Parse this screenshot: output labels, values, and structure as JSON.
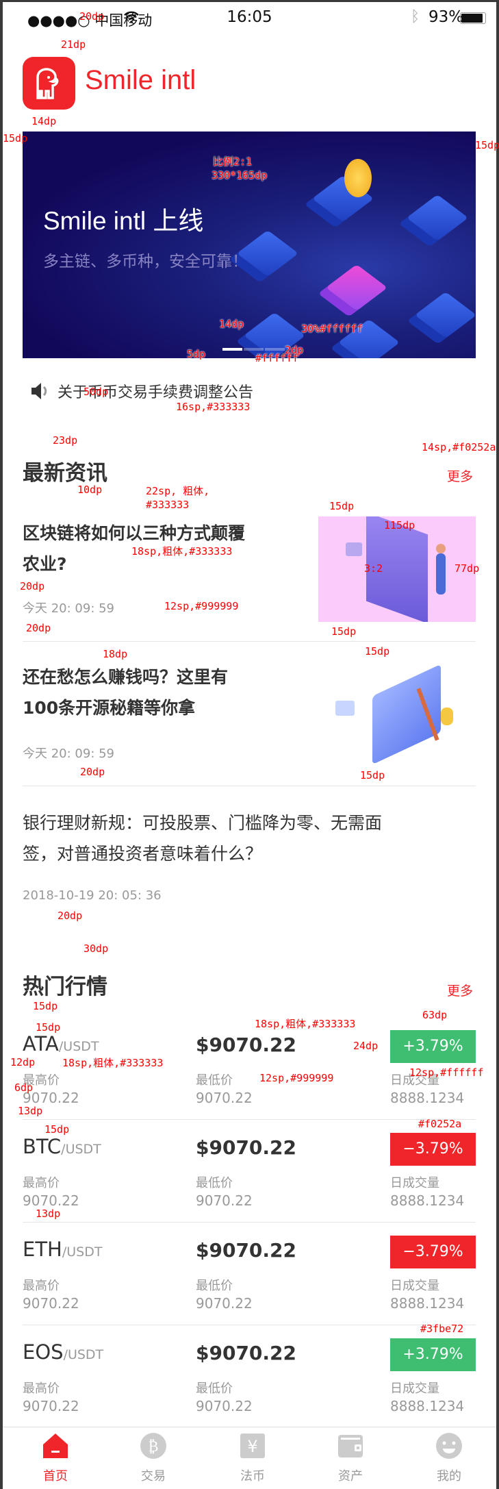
{
  "status_bar": {
    "carrier": "●●●●○ 中国移动",
    "time": "16:05",
    "battery": "93%"
  },
  "header": {
    "app_name": "Smile intl"
  },
  "banner": {
    "title": "Smile intl  上线",
    "subtitle": "多主链、多币种，安全可靠！",
    "slides": 3,
    "active_slide": 0
  },
  "notice": {
    "text": "关于币币交易手续费调整公告"
  },
  "news": {
    "title": "最新资讯",
    "more": "更多",
    "items": [
      {
        "title_l1": "区块链将如何以三种方式颠覆",
        "title_l2": "农业?",
        "time": "今天  20: 09: 59"
      },
      {
        "title_l1": "还在愁怎么赚钱吗？这里有",
        "title_l2": "100条开源秘籍等你拿",
        "time": "今天  20: 09: 59"
      },
      {
        "title_l1": "银行理财新规：可投股票、门槛降为零、无需面",
        "title_l2": "签，对普通投资者意味着什么？",
        "time": "2018-10-19  20: 05: 36"
      }
    ]
  },
  "market": {
    "title": "热门行情",
    "more": "更多",
    "labels": {
      "high": "最高价",
      "low": "最低价",
      "volume": "日成交量"
    },
    "rows": [
      {
        "symbol": "ATA",
        "quote": "/USDT",
        "price": "$9070.22",
        "change": "+3.79%",
        "dir": "up",
        "high": "9070.22",
        "low": "9070.22",
        "volume": "8888.1234"
      },
      {
        "symbol": "BTC",
        "quote": "/USDT",
        "price": "$9070.22",
        "change": "−3.79%",
        "dir": "down",
        "high": "9070.22",
        "low": "9070.22",
        "volume": "8888.1234"
      },
      {
        "symbol": "ETH",
        "quote": "/USDT",
        "price": "$9070.22",
        "change": "−3.79%",
        "dir": "down",
        "high": "9070.22",
        "low": "9070.22",
        "volume": "8888.1234"
      },
      {
        "symbol": "EOS",
        "quote": "/USDT",
        "price": "$9070.22",
        "change": "+3.79%",
        "dir": "up",
        "high": "9070.22",
        "low": "9070.22",
        "volume": "8888.1234"
      }
    ]
  },
  "tabs": [
    {
      "label": "首页",
      "icon": "home-icon",
      "active": true
    },
    {
      "label": "交易",
      "icon": "bitcoin-icon"
    },
    {
      "label": "法币",
      "icon": "yen-icon"
    },
    {
      "label": "资产",
      "icon": "wallet-icon"
    },
    {
      "label": "我的",
      "icon": "smiley-icon"
    }
  ],
  "colors": {
    "accent": "#f0252a",
    "up": "#3fbe72",
    "down": "#f0252a",
    "text": "#333333",
    "muted": "#999999"
  },
  "annotations": [
    "20dp",
    "21dp",
    "14dp",
    "15dp",
    "15dp",
    "比例2:1",
    "330*165dp",
    "14dp",
    "30%#ffffff",
    "5dp",
    "2dp",
    "#ffffff",
    "50dp",
    "16sp,#333333",
    "23dp",
    "14sp,#f0252a",
    "10dp",
    "22sp, 粗体,",
    "#333333",
    "15dp",
    "115dp",
    "18sp,粗体,#333333",
    "3:2",
    "77dp",
    "20dp",
    "12sp,#999999",
    "20dp",
    "15dp",
    "18dp",
    "15dp",
    "15dp",
    "20dp",
    "20dp",
    "30dp",
    "15dp",
    "15dp",
    "18sp,粗体,#333333",
    "63dp",
    "24dp",
    "12dp",
    "18sp,粗体,#333333",
    "6dp",
    "12sp,#999999",
    "12sp,#ffffff",
    "13dp",
    "15dp",
    "#f0252a",
    "13dp",
    "#3fbe72"
  ]
}
